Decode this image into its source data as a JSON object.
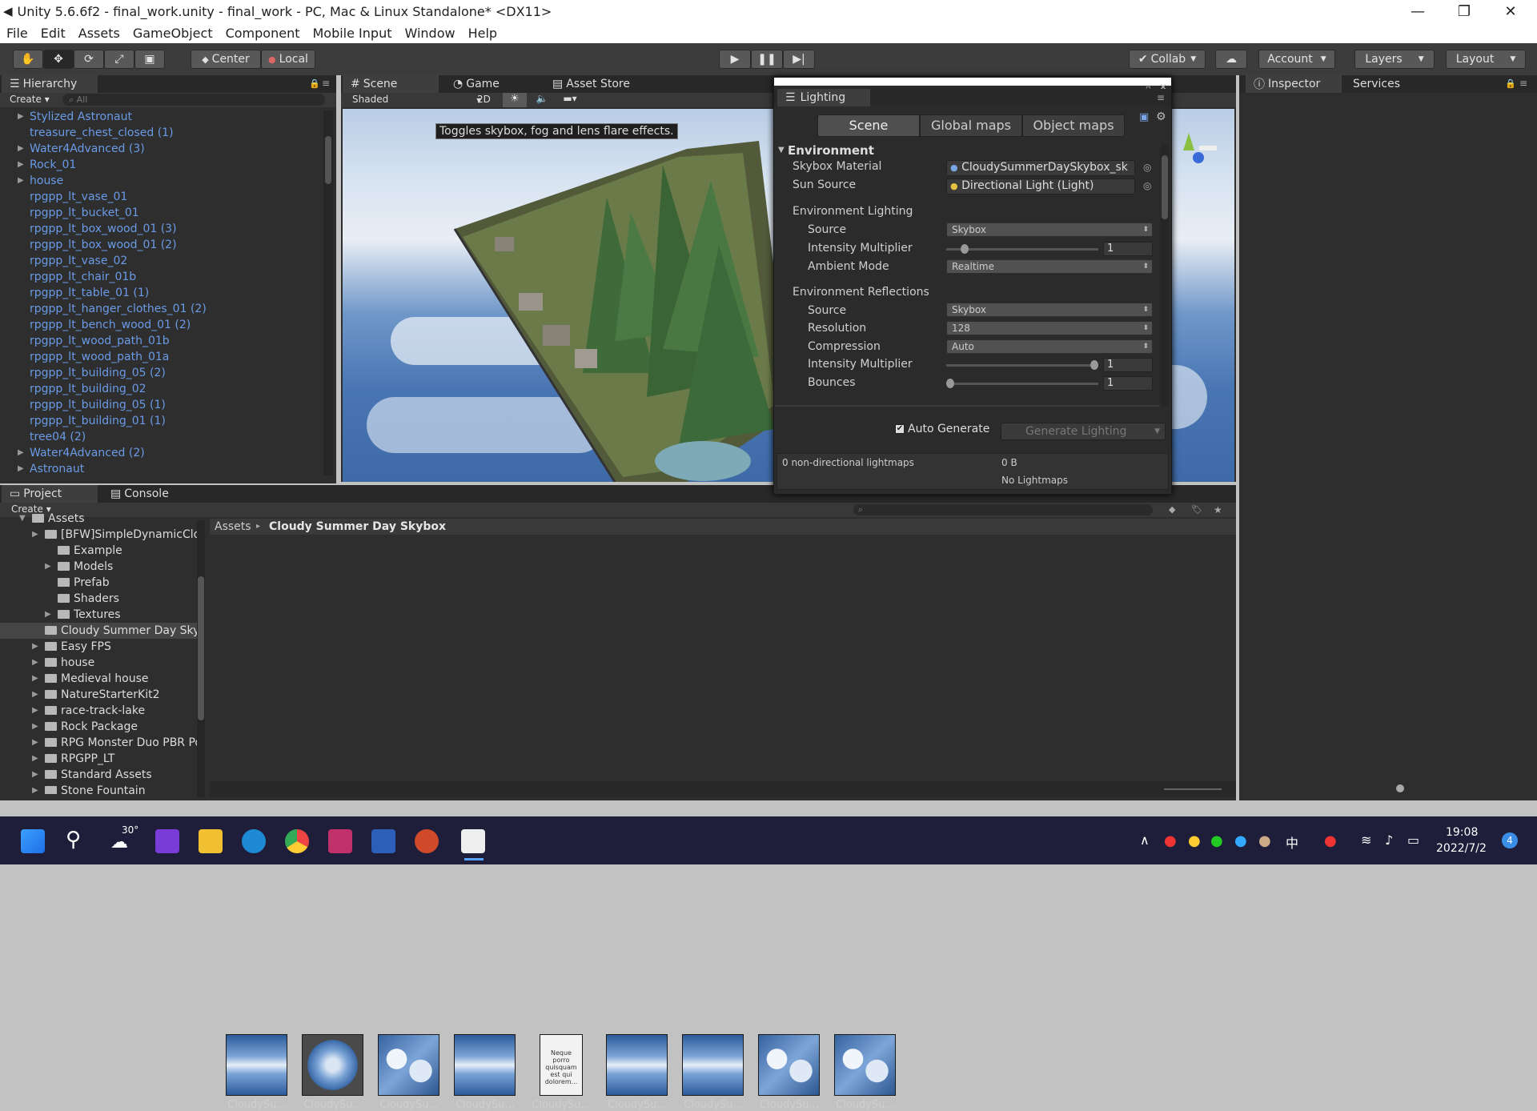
{
  "window": {
    "title": "Unity 5.6.6f2 - final_work.unity - final_work - PC, Mac & Linux Standalone* <DX11>",
    "minimize": "—",
    "maximize": "❐",
    "close": "✕"
  },
  "menu": [
    "File",
    "Edit",
    "Assets",
    "GameObject",
    "Component",
    "Mobile Input",
    "Window",
    "Help"
  ],
  "toolbar": {
    "pivot": "Center",
    "space": "Local",
    "collab": "Collab",
    "account": "Account",
    "layers": "Layers",
    "layout": "Layout"
  },
  "hierarchy": {
    "tab": "Hierarchy",
    "create": "Create",
    "search_placeholder": "All",
    "items": [
      {
        "label": "Stylized Astronaut",
        "expandable": true
      },
      {
        "label": "treasure_chest_closed (1)",
        "expandable": false
      },
      {
        "label": "Water4Advanced (3)",
        "expandable": true
      },
      {
        "label": "Rock_01",
        "expandable": true
      },
      {
        "label": "house",
        "expandable": true
      },
      {
        "label": "rpgpp_lt_vase_01",
        "expandable": false
      },
      {
        "label": "rpgpp_lt_bucket_01",
        "expandable": false
      },
      {
        "label": "rpgpp_lt_box_wood_01 (3)",
        "expandable": false
      },
      {
        "label": "rpgpp_lt_box_wood_01 (2)",
        "expandable": false
      },
      {
        "label": "rpgpp_lt_vase_02",
        "expandable": false
      },
      {
        "label": "rpgpp_lt_chair_01b",
        "expandable": false
      },
      {
        "label": "rpgpp_lt_table_01 (1)",
        "expandable": false
      },
      {
        "label": "rpgpp_lt_hanger_clothes_01 (2)",
        "expandable": false
      },
      {
        "label": "rpgpp_lt_bench_wood_01 (2)",
        "expandable": false
      },
      {
        "label": "rpgpp_lt_wood_path_01b",
        "expandable": false
      },
      {
        "label": "rpgpp_lt_wood_path_01a",
        "expandable": false
      },
      {
        "label": "rpgpp_lt_building_05 (2)",
        "expandable": false
      },
      {
        "label": "rpgpp_lt_building_02",
        "expandable": false
      },
      {
        "label": "rpgpp_lt_building_05 (1)",
        "expandable": false
      },
      {
        "label": "rpgpp_lt_building_01 (1)",
        "expandable": false
      },
      {
        "label": "tree04 (2)",
        "expandable": false
      },
      {
        "label": "Water4Advanced (2)",
        "expandable": true
      },
      {
        "label": "Astronaut",
        "expandable": true
      }
    ]
  },
  "scene": {
    "tabs": [
      "Scene",
      "Game",
      "Asset Store"
    ],
    "shading": "Shaded",
    "mode2d": "2D",
    "tooltip": "Toggles skybox, fog and lens flare effects."
  },
  "lighting": {
    "title": "Lighting",
    "tabs": [
      "Scene",
      "Global maps",
      "Object maps"
    ],
    "section": "Environment",
    "skybox_label": "Skybox Material",
    "skybox_value": "CloudySummerDaySkybox_sk",
    "sun_label": "Sun Source",
    "sun_value": "Directional Light (Light)",
    "env_lighting": "Environment Lighting",
    "source_label": "Source",
    "source_value": "Skybox",
    "intensity_label": "Intensity Multiplier",
    "intensity_value": "1",
    "intensity_level": 0.1,
    "ambient_label": "Ambient Mode",
    "ambient_value": "Realtime",
    "env_reflections": "Environment Reflections",
    "refl_source_label": "Source",
    "refl_source_value": "Skybox",
    "resolution_label": "Resolution",
    "resolution_value": "128",
    "compression_label": "Compression",
    "compression_value": "Auto",
    "refl_intensity_label": "Intensity Multiplier",
    "refl_intensity_value": "1",
    "refl_intensity_level": 1.0,
    "bounces_label": "Bounces",
    "bounces_value": "1",
    "bounces_level": 0.0,
    "auto_generate": "Auto Generate",
    "generate_button": "Generate Lighting",
    "lightmaps_info": "0 non-directional lightmaps",
    "lightmaps_size": "0 B",
    "no_lightmaps": "No Lightmaps"
  },
  "inspector": {
    "tabs": [
      "Inspector",
      "Services"
    ]
  },
  "project": {
    "tabs": [
      "Project",
      "Console"
    ],
    "create": "Create",
    "tree": [
      {
        "label": "Assets",
        "depth": 0,
        "arrow": true
      },
      {
        "label": "[BFW]SimpleDynamicClo",
        "depth": 1,
        "arrow": true
      },
      {
        "label": "Example",
        "depth": 2,
        "arrow": false
      },
      {
        "label": "Models",
        "depth": 2,
        "arrow": true
      },
      {
        "label": "Prefab",
        "depth": 2,
        "arrow": false
      },
      {
        "label": "Shaders",
        "depth": 2,
        "arrow": false
      },
      {
        "label": "Textures",
        "depth": 2,
        "arrow": true
      },
      {
        "label": "Cloudy Summer Day Sky",
        "depth": 1,
        "arrow": false,
        "selected": true
      },
      {
        "label": "Easy FPS",
        "depth": 1,
        "arrow": true
      },
      {
        "label": "house",
        "depth": 1,
        "arrow": true
      },
      {
        "label": "Medieval house",
        "depth": 1,
        "arrow": true
      },
      {
        "label": "NatureStarterKit2",
        "depth": 1,
        "arrow": true
      },
      {
        "label": "race-track-lake",
        "depth": 1,
        "arrow": true
      },
      {
        "label": "Rock Package",
        "depth": 1,
        "arrow": true
      },
      {
        "label": "RPG Monster Duo PBR Po",
        "depth": 1,
        "arrow": true
      },
      {
        "label": "RPGPP_LT",
        "depth": 1,
        "arrow": true
      },
      {
        "label": "Standard Assets",
        "depth": 1,
        "arrow": true
      },
      {
        "label": "Stone Fountain",
        "depth": 1,
        "arrow": true
      }
    ],
    "breadcrumb_root": "Assets",
    "breadcrumb_current": "Cloudy Summer Day Skybox",
    "assets": [
      {
        "label": "CloudySu...",
        "kind": "cube"
      },
      {
        "label": "CloudySu...",
        "kind": "sphere"
      },
      {
        "label": "CloudySu...",
        "kind": "clouds"
      },
      {
        "label": "CloudySu...",
        "kind": "cube"
      },
      {
        "label": "CloudySu...",
        "kind": "doc"
      },
      {
        "label": "CloudySu...",
        "kind": "cube"
      },
      {
        "label": "CloudySu...",
        "kind": "cube"
      },
      {
        "label": "CloudySu...",
        "kind": "clouds"
      },
      {
        "label": "CloudySu...",
        "kind": "clouds"
      }
    ],
    "doc_text": "Neque porro quisquam est qui dolorem..."
  },
  "taskbar": {
    "weather": "30°",
    "ime": "中",
    "time": "19:08",
    "date": "2022/7/2",
    "badge": "4"
  },
  "colors": {
    "editor_bg": "#c2c2c2",
    "toolbar": "#3c3c3c",
    "panel": "#2e2e2e",
    "link": "#6a9be6",
    "taskbar": "#1e1e3a"
  }
}
